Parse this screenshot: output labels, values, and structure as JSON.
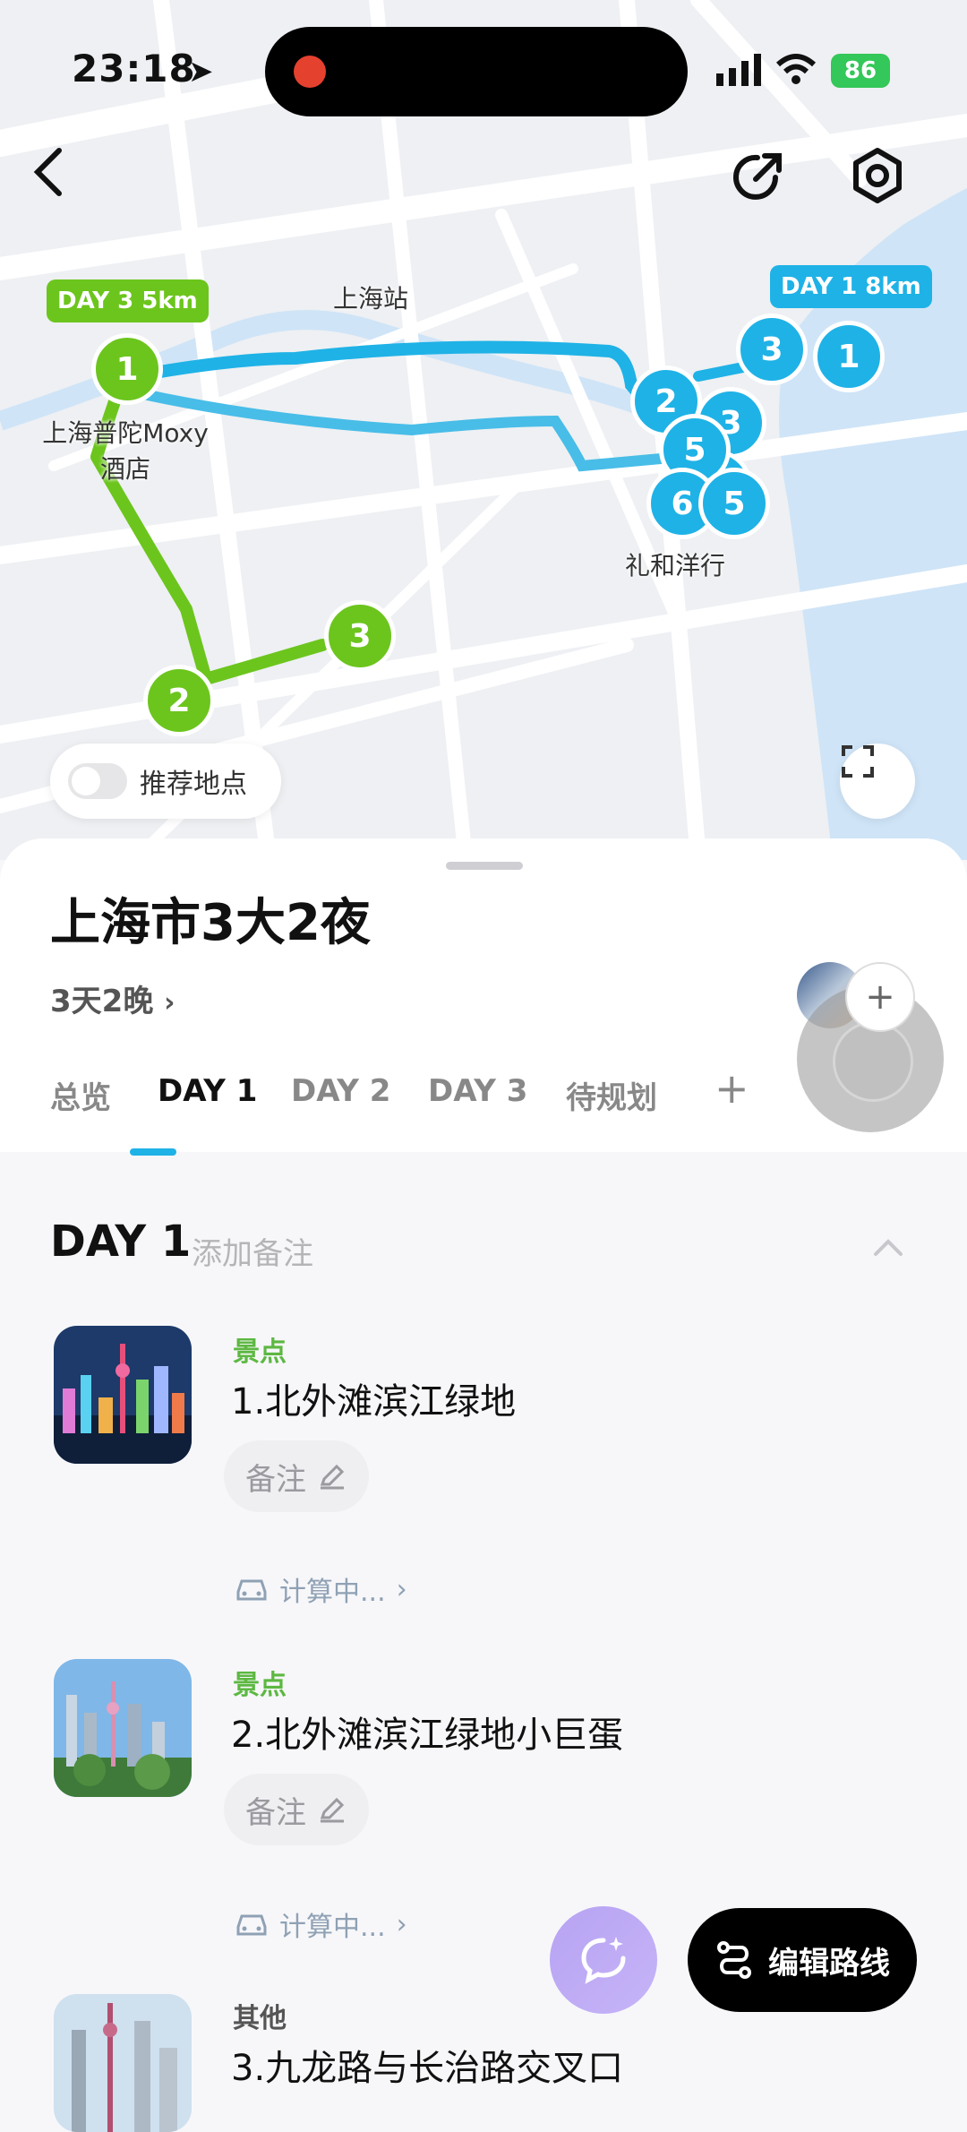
{
  "status": {
    "time": "23:18",
    "battery": "86"
  },
  "map": {
    "day3_pill": "DAY 3 5km",
    "day1_pill": "DAY 1 8km",
    "station_label": "上海站",
    "hotel_label_line1": "上海普陀Moxy",
    "hotel_label_line2": "酒店",
    "lihe_label": "礼和洋行",
    "green_markers": [
      "1",
      "2",
      "3"
    ],
    "blue_markers": [
      "3",
      "1",
      "2",
      "3",
      "5",
      "5",
      "6",
      "5"
    ],
    "toggle_label": "推荐地点",
    "colors": {
      "day3": "#6cc51d",
      "day1": "#1fb2e6"
    }
  },
  "trip": {
    "title": "上海市3大2夜",
    "duration": "3天2晚",
    "add_member": "+"
  },
  "tabs": [
    "总览",
    "DAY 1",
    "DAY 2",
    "DAY 3",
    "待规划",
    "+"
  ],
  "day": {
    "heading": "DAY 1",
    "note_placeholder": "添加备注",
    "items": [
      {
        "category": "景点",
        "name": "1.北外滩滨江绿地",
        "note": "备注",
        "transit": "计算中..."
      },
      {
        "category": "景点",
        "name": "2.北外滩滨江绿地小巨蛋",
        "note": "备注",
        "transit": "计算中..."
      },
      {
        "category": "其他",
        "name": "3.九龙路与长治路交叉口"
      }
    ]
  },
  "actions": {
    "edit_route": "编辑路线"
  }
}
